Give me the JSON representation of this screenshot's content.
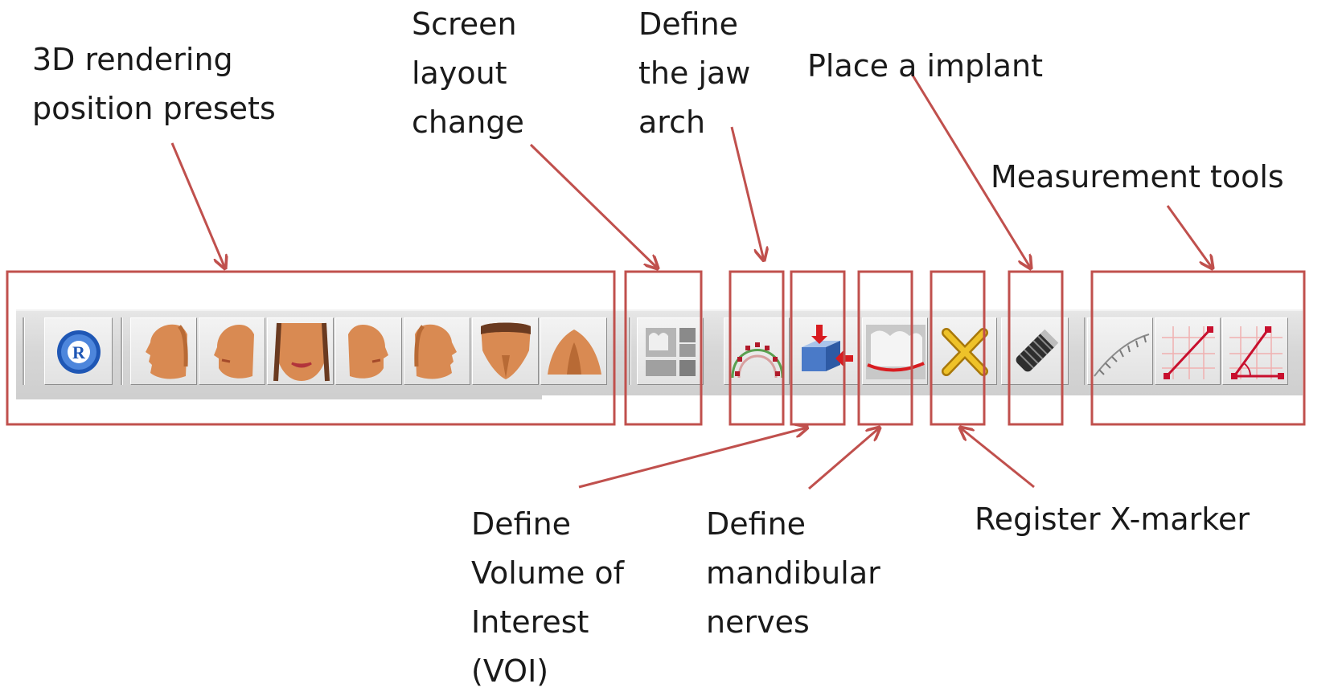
{
  "labels": {
    "presets": [
      "3D rendering",
      "position presets"
    ],
    "layout": [
      "Screen",
      "layout",
      "change"
    ],
    "jaw": [
      "Define",
      "the jaw",
      "arch"
    ],
    "implant": [
      "Place a implant"
    ],
    "measure": [
      "Measurement tools"
    ],
    "voi": [
      "Define",
      "Volume of",
      "Interest",
      "(VOI)"
    ],
    "nerves": [
      "Define",
      "mandibular",
      "nerves"
    ],
    "xmarker": [
      "Register X-marker"
    ]
  },
  "toolbar": {
    "buttons": [
      {
        "icon": "reset-view-icon",
        "glyph": "R"
      },
      {
        "icon": "face-left-profile-icon"
      },
      {
        "icon": "face-left-oblique-icon"
      },
      {
        "icon": "face-frontal-icon"
      },
      {
        "icon": "face-right-oblique-icon"
      },
      {
        "icon": "face-right-profile-icon"
      },
      {
        "icon": "face-top-view-icon"
      },
      {
        "icon": "face-bottom-view-icon"
      },
      {
        "icon": "screen-layout-icon"
      },
      {
        "icon": "jaw-arch-icon"
      },
      {
        "icon": "volume-of-interest-icon"
      },
      {
        "icon": "mandibular-nerve-icon"
      },
      {
        "icon": "x-marker-icon"
      },
      {
        "icon": "implant-icon"
      },
      {
        "icon": "curved-ruler-icon"
      },
      {
        "icon": "distance-measure-icon"
      },
      {
        "icon": "angle-measure-icon"
      }
    ]
  },
  "colors": {
    "annotation": "#c0504d",
    "skin": "#d98a52",
    "reset_blue": "#2a66c8",
    "marker_yellow": "#e8b418",
    "measure_red": "#c8102e"
  }
}
